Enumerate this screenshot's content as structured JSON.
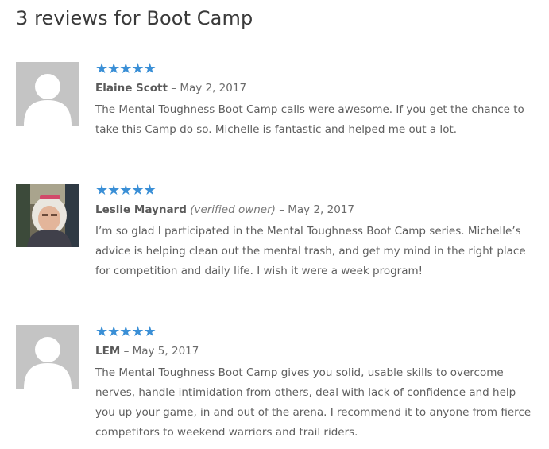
{
  "reviews_heading": "3 reviews for Boot Camp",
  "colors": {
    "star": "#3a8fd6",
    "avatar_placeholder": "#c4c4c4"
  },
  "reviews": [
    {
      "author": "Elaine Scott",
      "verified_label": "",
      "separator": "–",
      "date": "May 2, 2017",
      "rating": 5,
      "stars": "★★★★★",
      "avatar": "placeholder-avatar",
      "text": "The Mental Toughness Boot Camp calls were awesome. If you get the chance to take this Camp do so. Michelle is fantastic and helped me out a lot."
    },
    {
      "author": "Leslie Maynard",
      "verified_label": "(verified owner)",
      "separator": "–",
      "date": "May 2, 2017",
      "rating": 5,
      "stars": "★★★★★",
      "avatar": "photo-avatar",
      "text": "I’m so glad I participated in the Mental Toughness Boot Camp series. Michelle’s advice is helping clean out the mental trash, and get my mind in the right place for competition and daily life. I wish it were a week program!"
    },
    {
      "author": "LEM",
      "verified_label": "",
      "separator": "–",
      "date": "May 5, 2017",
      "rating": 5,
      "stars": "★★★★★",
      "avatar": "placeholder-avatar",
      "text": "The Mental Toughness Boot Camp gives you solid, usable skills to overcome nerves, handle intimidation from others, deal with lack of confidence and help you up your game, in and out of the arena. I recommend it to anyone from fierce competitors to weekend warriors and trail riders."
    }
  ]
}
